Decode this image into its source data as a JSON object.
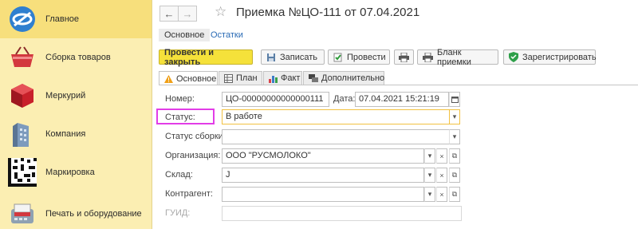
{
  "sidebar": {
    "items": [
      {
        "label": "Главное",
        "icon": "1c-logo-icon"
      },
      {
        "label": "Сборка товаров",
        "icon": "shopping-basket-icon"
      },
      {
        "label": "Меркурий",
        "icon": "red-cube-icon"
      },
      {
        "label": "Компания",
        "icon": "building-icon"
      },
      {
        "label": "Маркировка",
        "icon": "datamatrix-icon"
      },
      {
        "label": "Печать и оборудование",
        "icon": "card-reader-icon"
      }
    ]
  },
  "header": {
    "title": "Приемка №ЦО-111 от 07.04.2021",
    "back": "←",
    "forward": "→",
    "star": "☆"
  },
  "subnav": {
    "main": "Основное",
    "remains": "Остатки"
  },
  "toolbar": {
    "post_close": "Провести и закрыть",
    "save": "Записать",
    "post": "Провести",
    "form": "Бланк приемки",
    "register": "Зарегистрировать"
  },
  "tabs": [
    "Основное",
    "План",
    "Факт",
    "Дополнительно"
  ],
  "form": {
    "number_label": "Номер:",
    "number_value": "ЦО-00000000000000111",
    "date_label": "Дата:",
    "date_value": "07.04.2021 15:21:19",
    "status_label": "Статус:",
    "status_value": "В работе",
    "assembly_status_label": "Статус сборки:",
    "assembly_status_value": "",
    "org_label": "Организация:",
    "org_value": "ООО \"РУСМОЛОКО\"",
    "warehouse_label": "Склад:",
    "warehouse_value": "J",
    "counterparty_label": "Контрагент:",
    "counterparty_value": "",
    "guid_label": "ГУИД:",
    "guid_value": ""
  },
  "colors": {
    "sidebar_bg": "#fbeeb2",
    "primary_button": "#f5e13a",
    "highlight_box": "#e23de7"
  }
}
